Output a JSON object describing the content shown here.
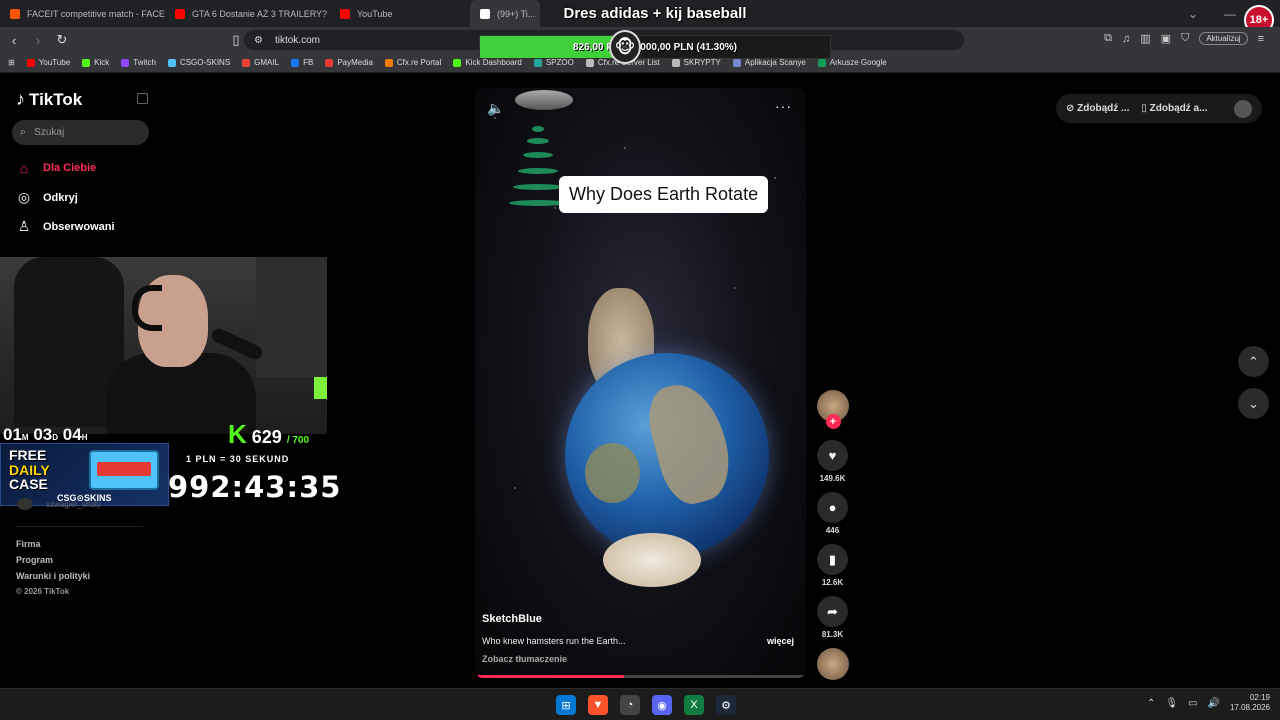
{
  "browser": {
    "tabs": [
      {
        "title": "FACEIT competitive match - FACEIT.c"
      },
      {
        "title": "GTA 6 Dostanie AŻ 3 TRAILERY? — P"
      },
      {
        "title": "YouTube"
      },
      {
        "title": "(99+) Ti..."
      }
    ],
    "url": "tiktok.com",
    "update_label": "Aktualizuj",
    "bookmarks": [
      "YouTube",
      "Kick",
      "Twitch",
      "CSGO-SKINS",
      "GMAIL",
      "FB",
      "PayMedia",
      "Cfx.re Portal",
      "Kick Dashboard",
      "SPZOO",
      "Cfx.re Server List",
      "SKRYPTY",
      "Aplikacja Scanye",
      "Arkusze Google"
    ],
    "age_badge": "18+"
  },
  "stream_overlay": {
    "goal_title": "Dres adidas + kij baseball",
    "goal_text": "826,00 PLN / 2000,00 PLN (41.30%)",
    "goal_percent": 41.3,
    "timer": {
      "d": "01",
      "d_unit": "M",
      "h": "03",
      "h_unit": "D",
      "m": "04",
      "m_unit": "H"
    },
    "kick_count": "629",
    "kick_max": "/ 700",
    "rate": "1 PLN = 30 SEKUND",
    "countdown": "992:43:35",
    "daily_case": {
      "line1": "FREE",
      "line2": "DAILY",
      "line3": "CASE",
      "brand": "CSG⊙SKINS"
    },
    "under_name": "szwagier_shoty"
  },
  "tiktok": {
    "logo": "TikTok",
    "search_placeholder": "Szukaj",
    "nav": [
      {
        "label": "Dla Ciebie",
        "icon": "home-icon"
      },
      {
        "label": "Odkryj",
        "icon": "compass-icon"
      },
      {
        "label": "Obserwowani",
        "icon": "following-icon"
      }
    ],
    "footer": [
      "Firma",
      "Program",
      "Warunki i polityki",
      "© 2026 TikTok"
    ],
    "top_right": [
      "Zdobądź ...",
      "Zdobądź a..."
    ],
    "video": {
      "title_card": "Why Does Earth Rotate",
      "author": "SketchBlue",
      "caption": "Who knew hamsters run the Earth...",
      "more": "więcej",
      "translate": "Zobacz tłumaczenie",
      "progress": 0.45
    },
    "actions": {
      "likes": "149.6K",
      "comments": "446",
      "saves": "12.6K",
      "shares": "81.3K"
    }
  },
  "taskbar": {
    "time": "02:19",
    "date": "17.08.2026"
  }
}
